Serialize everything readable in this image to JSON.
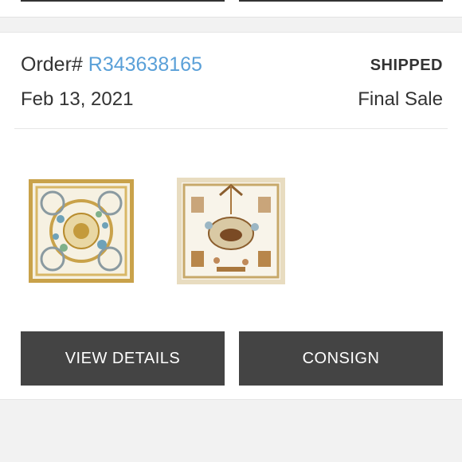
{
  "order": {
    "label": "Order# ",
    "number": "R343638165",
    "status": "SHIPPED",
    "date": "Feb 13, 2021",
    "sale_type": "Final Sale"
  },
  "buttons": {
    "view_details": "VIEW DETAILS",
    "consign": "CONSIGN"
  },
  "colors": {
    "order_number": "#5aa0d8",
    "button_bg": "#444444",
    "page_bg": "#f2f2f2"
  }
}
